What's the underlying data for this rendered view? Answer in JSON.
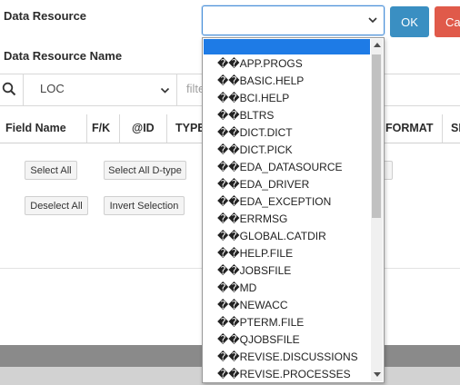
{
  "form": {
    "data_resource_label": "Data Resource",
    "data_resource_name_label": "Data Resource Name",
    "ok_label": "OK",
    "cancel_label": "Ca"
  },
  "search": {
    "column_select_value": "LOC",
    "filter_placeholder": "filte"
  },
  "table": {
    "headers": [
      "Field Name",
      "F/K",
      "@ID",
      "TYPE",
      "FORMAT",
      "SI"
    ]
  },
  "actions": {
    "select_all": "Select All",
    "select_all_dtype": "Select All D-type",
    "deselect_all": "Deselect All",
    "invert_selection": "Invert Selection"
  },
  "dropdown": {
    "options": [
      "",
      "��APP.PROGS",
      "��BASIC.HELP",
      "��BCI.HELP",
      "��BLTRS",
      "��DICT.DICT",
      "��DICT.PICK",
      "��EDA_DATASOURCE",
      "��EDA_DRIVER",
      "��EDA_EXCEPTION",
      "��ERRMSG",
      "��GLOBAL.CATDIR",
      "��HELP.FILE",
      "��JOBSFILE",
      "��MD",
      "��NEWACC",
      "��PTERM.FILE",
      "��QJOBSFILE",
      "��REVISE.DISCUSSIONS",
      "��REVISE.PROCESSES"
    ]
  },
  "colors": {
    "accent_blue": "#3a8fc2",
    "cancel_red": "#e05a4a",
    "highlight": "#1e7be6"
  }
}
